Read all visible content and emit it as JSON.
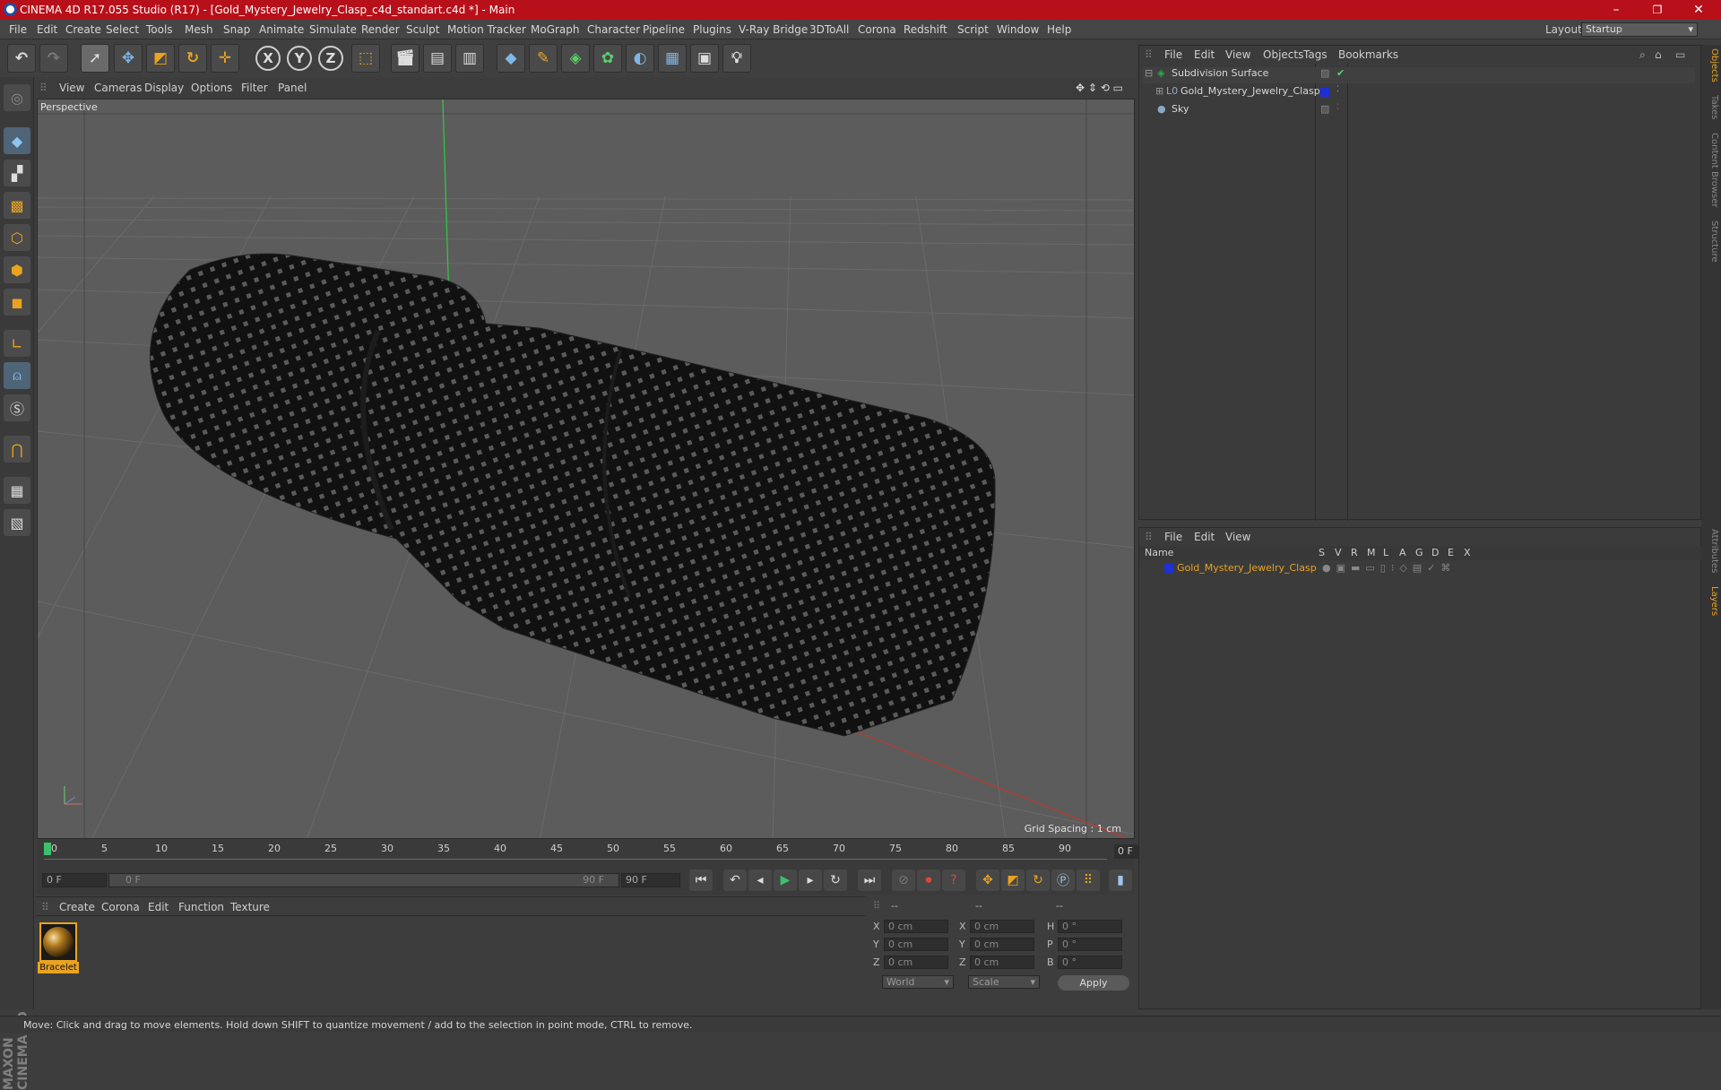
{
  "window": {
    "title": "CINEMA 4D R17.055 Studio (R17) - [Gold_Mystery_Jewelry_Clasp_c4d_standart.c4d *] - Main",
    "minimize": "–",
    "maximize": "❐",
    "close": "✕"
  },
  "menu": [
    "File",
    "Edit",
    "Create",
    "Select",
    "Tools",
    "Mesh",
    "Snap",
    "Animate",
    "Simulate",
    "Render",
    "Sculpt",
    "Motion Tracker",
    "MoGraph",
    "Character",
    "Pipeline",
    "Plugins",
    "V-Ray Bridge",
    "3DToAll",
    "Corona",
    "Redshift",
    "Script",
    "Window",
    "Help"
  ],
  "layout": {
    "label": "Layout:",
    "value": "Startup"
  },
  "toolbar": {
    "x": "X",
    "y": "Y",
    "z": "Z"
  },
  "viewport": {
    "menu": [
      "View",
      "Cameras",
      "Display",
      "Options",
      "Filter",
      "Panel"
    ],
    "label": "Perspective",
    "grid_spacing": "Grid Spacing : 1 cm"
  },
  "timeline": {
    "ticks": [
      "0",
      "5",
      "10",
      "15",
      "20",
      "25",
      "30",
      "35",
      "40",
      "45",
      "50",
      "55",
      "60",
      "65",
      "70",
      "75",
      "80",
      "85",
      "90"
    ],
    "current_frame": "0 F",
    "start_field": "0 F",
    "range_start": "0 F",
    "range_end": "90 F",
    "end_field": "90 F"
  },
  "materials": {
    "menu": [
      "Create",
      "Corona",
      "Edit",
      "Function",
      "Texture"
    ],
    "items": [
      {
        "name": "Bracelet"
      }
    ]
  },
  "coordinates": {
    "header": [
      "--",
      "--",
      "--"
    ],
    "rows": [
      {
        "a": "X",
        "av": "0 cm",
        "b": "X",
        "bv": "0 cm",
        "c": "H",
        "cv": "0 °"
      },
      {
        "a": "Y",
        "av": "0 cm",
        "b": "Y",
        "bv": "0 cm",
        "c": "P",
        "cv": "0 °"
      },
      {
        "a": "Z",
        "av": "0 cm",
        "b": "Z",
        "bv": "0 cm",
        "c": "B",
        "cv": "0 °"
      }
    ],
    "space": "World",
    "mode": "Scale",
    "apply": "Apply"
  },
  "object_manager": {
    "menu": [
      "File",
      "Edit",
      "View",
      "Objects",
      "Tags",
      "Bookmarks"
    ],
    "objects": [
      {
        "name": "Subdivision Surface",
        "color": "#2ea84a"
      },
      {
        "name": "Gold_Mystery_Jewelry_Clasp",
        "color": "#9aa8c0"
      },
      {
        "name": "Sky",
        "color": "#8aa7c9"
      }
    ]
  },
  "layer_manager": {
    "menu": [
      "File",
      "Edit",
      "View"
    ],
    "columns": [
      "Name",
      "S",
      "V",
      "R",
      "M",
      "L",
      "A",
      "G",
      "D",
      "E",
      "X"
    ],
    "layers": [
      {
        "name": "Gold_Mystery_Jewelry_Clasp",
        "color": "#1f2fd6"
      }
    ]
  },
  "side_tabs": [
    "Objects",
    "Takes",
    "Content Browser",
    "Structure",
    "Attributes",
    "Layers"
  ],
  "brand": "MAXON CINEMA 4D",
  "status": "Move: Click and drag to move elements. Hold down SHIFT to quantize movement / add to the selection in point mode, CTRL to remove.",
  "colors": {
    "accent": "#e9a321",
    "title_bar": "#b8101a",
    "layer_name": "#e9a321"
  }
}
